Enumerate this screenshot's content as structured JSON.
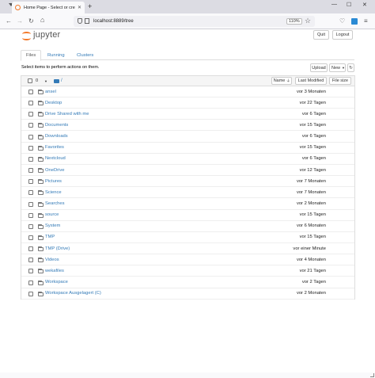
{
  "browser": {
    "tab_title": "Home Page - Select or create a",
    "url": "localhost:8889/tree",
    "zoom": "110%"
  },
  "jupyter": {
    "logo_text": "jupyter",
    "quit_label": "Quit",
    "logout_label": "Logout",
    "tabs": [
      {
        "label": "Files",
        "active": true
      },
      {
        "label": "Running",
        "active": false
      },
      {
        "label": "Clusters",
        "active": false
      }
    ],
    "instruction": "Select items to perform actions on them.",
    "upload_label": "Upload",
    "new_label": "New",
    "selected_count": "0",
    "breadcrumb_root": "/",
    "sort_name_label": "Name",
    "last_modified_label": "Last Modified",
    "file_size_label": "File size",
    "items": [
      {
        "name": "ansel",
        "modified": "vor 3 Monaten"
      },
      {
        "name": "Desktop",
        "modified": "vor 22 Tagen"
      },
      {
        "name": "Drive Shared with me",
        "modified": "vor 6 Tagen"
      },
      {
        "name": "Documents",
        "modified": "vor 15 Tagen"
      },
      {
        "name": "Downloads",
        "modified": "vor 6 Tagen"
      },
      {
        "name": "Favorites",
        "modified": "vor 15 Tagen"
      },
      {
        "name": "Nextcloud",
        "modified": "vor 6 Tagen"
      },
      {
        "name": "OneDrive",
        "modified": "vor 12 Tagen"
      },
      {
        "name": "Pictures",
        "modified": "vor 7 Monaten"
      },
      {
        "name": "Science",
        "modified": "vor 7 Monaten"
      },
      {
        "name": "Searches",
        "modified": "vor 2 Monaten"
      },
      {
        "name": "source",
        "modified": "vor 15 Tagen"
      },
      {
        "name": "System",
        "modified": "vor 6 Monaten"
      },
      {
        "name": "TMP",
        "modified": "vor 15 Tagen"
      },
      {
        "name": "TMP (Drive)",
        "modified": "vor einer Minute"
      },
      {
        "name": "Videos",
        "modified": "vor 4 Monaten"
      },
      {
        "name": "wekafiles",
        "modified": "vor 21 Tagen"
      },
      {
        "name": "Workspace",
        "modified": "vor 2 Tagen"
      },
      {
        "name": "Workspace Ausgelagert (C)",
        "modified": "vor 2 Monaten"
      }
    ]
  }
}
